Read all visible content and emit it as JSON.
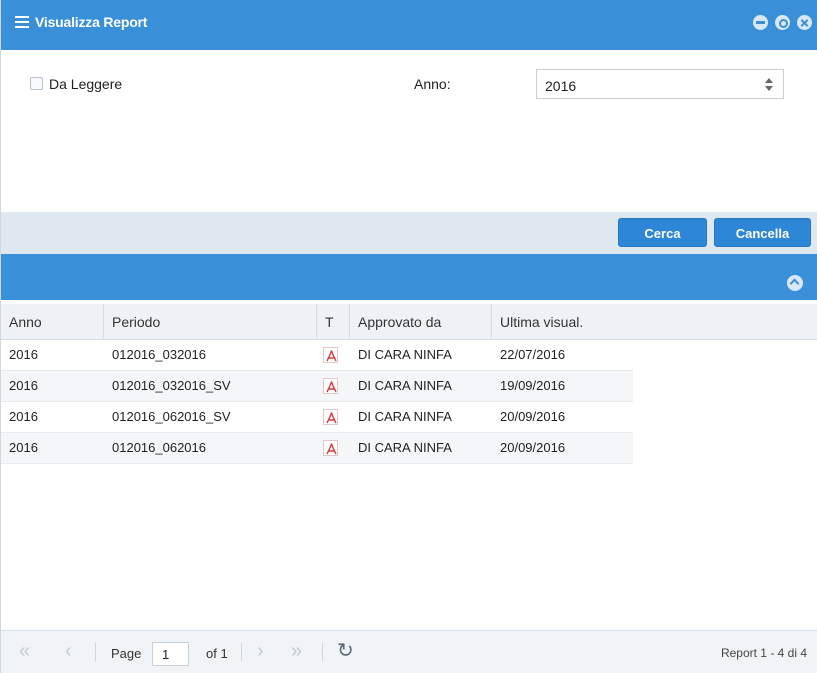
{
  "window": {
    "title": "Visualizza Report",
    "accent_color": "#3a90d8",
    "controls": [
      "minimize-icon",
      "restore-icon",
      "close-icon"
    ]
  },
  "filters": {
    "da_leggere_label": "Da Leggere",
    "da_leggere_checked": false,
    "anno_label": "Anno:",
    "anno_value": "2016"
  },
  "buttons": {
    "cerca": "Cerca",
    "cancella": "Cancella"
  },
  "grid": {
    "columns": [
      "Anno",
      "Periodo",
      "T",
      "Approvato da",
      "Ultima visual."
    ],
    "rows": [
      {
        "anno": "2016",
        "periodo": "012016_032016",
        "tipo_icon": "pdf-icon",
        "approvato_da": "DI CARA NINFA",
        "ultima_visual": "22/07/2016"
      },
      {
        "anno": "2016",
        "periodo": "012016_032016_SV",
        "tipo_icon": "pdf-icon",
        "approvato_da": "DI CARA NINFA",
        "ultima_visual": "19/09/2016"
      },
      {
        "anno": "2016",
        "periodo": "012016_062016_SV",
        "tipo_icon": "pdf-icon",
        "approvato_da": "DI CARA NINFA",
        "ultima_visual": "20/09/2016"
      },
      {
        "anno": "2016",
        "periodo": "012016_062016",
        "tipo_icon": "pdf-icon",
        "approvato_da": "DI CARA NINFA",
        "ultima_visual": "20/09/2016"
      }
    ]
  },
  "pager": {
    "page_label": "Page",
    "page_value": "1",
    "of_label": "of 1",
    "display_msg": "Report 1 - 4 di 4"
  }
}
